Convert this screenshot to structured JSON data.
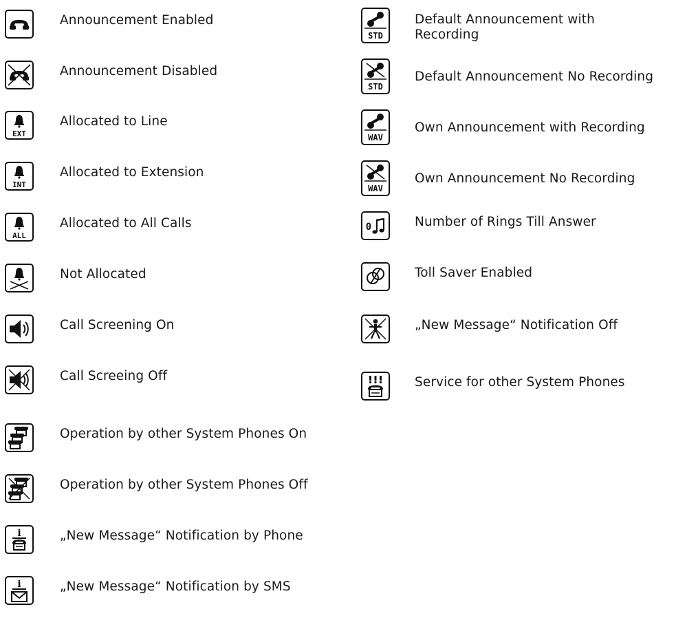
{
  "left_column": [
    {
      "icon": "announcement-enabled-icon",
      "label": "Announcement Enabled"
    },
    {
      "icon": "announcement-disabled-icon",
      "label": "Announcement Disabled"
    },
    {
      "icon": "allocated-line-icon",
      "label": "Allocated to Line",
      "icon_text": "EXT"
    },
    {
      "icon": "allocated-extension-icon",
      "label": "Allocated to Extension",
      "icon_text": "INT"
    },
    {
      "icon": "allocated-all-icon",
      "label": "Allocated to All Calls",
      "icon_text": "ALL"
    },
    {
      "icon": "not-allocated-icon",
      "label": "Not Allocated"
    },
    {
      "icon": "speaker-on-icon",
      "label": "Call Screening On"
    },
    {
      "icon": "speaker-off-icon",
      "label": "Call Screeing Off"
    },
    {
      "icon": "system-phones-on-icon",
      "label": "Operation by other System Phones On"
    },
    {
      "icon": "system-phones-off-icon",
      "label": "Operation by other System Phones Off"
    },
    {
      "icon": "notify-phone-icon",
      "label": "„New Message“ Notification by Phone",
      "icon_text": "i"
    },
    {
      "icon": "notify-sms-icon",
      "label": "„New Message“ Notification by SMS",
      "icon_text": "i"
    }
  ],
  "right_column": [
    {
      "icon": "default-announcement-recording-icon",
      "label": "Default Announcement with Recording",
      "icon_text": "STD"
    },
    {
      "icon": "default-announcement-no-recording-icon",
      "label": "Default Announcement No Recording",
      "icon_text": "STD"
    },
    {
      "icon": "own-announcement-recording-icon",
      "label": "Own Announcement with Recording",
      "icon_text": "WAV"
    },
    {
      "icon": "own-announcement-no-recording-icon",
      "label": "Own Announcement No Recording",
      "icon_text": "WAV"
    },
    {
      "icon": "rings-till-answer-icon",
      "label": "Number of Rings Till Answer",
      "icon_text": "0"
    },
    {
      "icon": "toll-saver-icon",
      "label": "Toll Saver Enabled"
    },
    {
      "icon": "notification-off-icon",
      "label": "„New Message“ Notification Off"
    },
    {
      "icon": "service-system-phones-icon",
      "label": "Service for other System Phones"
    }
  ],
  "colors": {
    "ink": "#111111",
    "text": "#1a1a1a",
    "background": "#ffffff"
  }
}
